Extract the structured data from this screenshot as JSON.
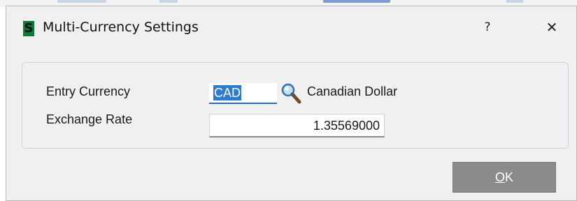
{
  "dialog": {
    "icon_letter": "S",
    "title": "Multi-Currency Settings",
    "help_label": "?",
    "close_label": "✕"
  },
  "form": {
    "entry_currency_label": "Entry Currency",
    "entry_currency_value": "CAD",
    "currency_description": "Canadian Dollar",
    "exchange_rate_label": "Exchange Rate",
    "exchange_rate_value": "1.35569000",
    "lookup_icon": "search-icon"
  },
  "buttons": {
    "ok_mnemonic": "O",
    "ok_rest": "K"
  },
  "colors": {
    "app_icon": "#0b7a35",
    "selection": "#2f7bd1",
    "ok_button": "#8b8b8b"
  }
}
